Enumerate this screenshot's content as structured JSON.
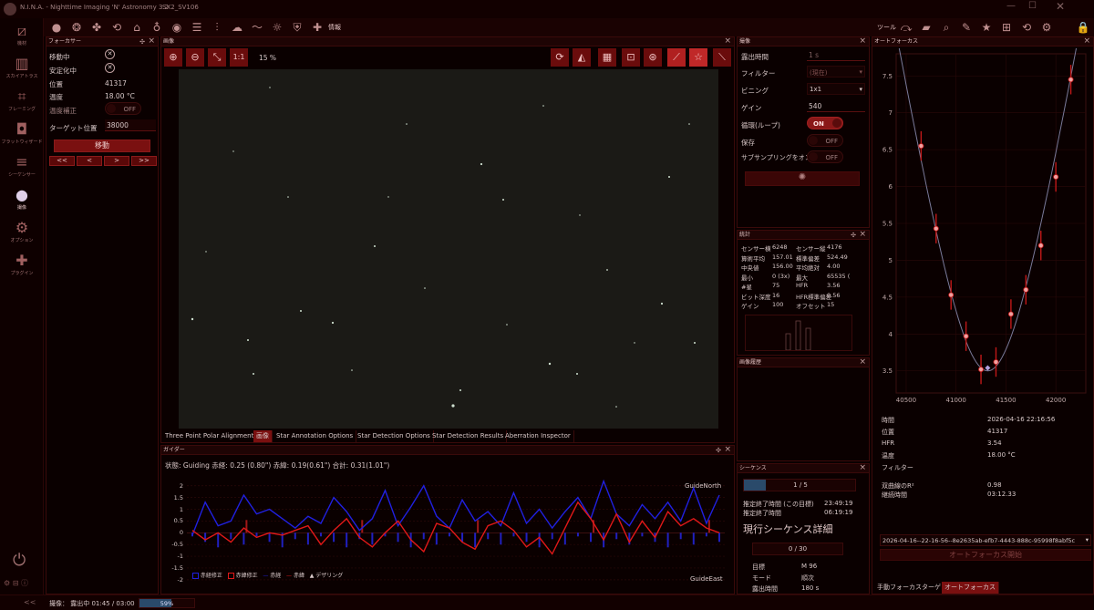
{
  "titlebar": {
    "app": "N.I.N.A. - Nighttime Imaging 'N' Astronomy 3.2",
    "profile": "SX2_SV106",
    "info_label": "情報",
    "tools_label": "ツール"
  },
  "sidebar": {
    "items": [
      {
        "label": "機材",
        "icon": "telescope-icon"
      },
      {
        "label": "スカイアトラス",
        "icon": "atlas-icon"
      },
      {
        "label": "フレーミング",
        "icon": "framing-icon"
      },
      {
        "label": "フラットウィザード",
        "icon": "flat-icon"
      },
      {
        "label": "シーケンサー",
        "icon": "sequencer-icon"
      },
      {
        "label": "撮像",
        "icon": "imaging-icon"
      },
      {
        "label": "オプション",
        "icon": "gear-icon"
      },
      {
        "label": "プラグイン",
        "icon": "puzzle-icon"
      }
    ]
  },
  "focuser": {
    "title": "フォーカサー",
    "moving_label": "移動中",
    "settled_label": "安定化中",
    "position_label": "位置",
    "position": "41317",
    "temp_label": "温度",
    "temp": "18.00 °C",
    "tempcomp_label": "温度補正",
    "tempcomp": "OFF",
    "target_label": "ターゲット位置",
    "target": "38000",
    "move_button": "移動",
    "step_buttons": [
      "<<",
      "<",
      ">",
      ">>"
    ]
  },
  "image": {
    "title": "画像",
    "zoom_fit": "1:1",
    "zoom": "15 %"
  },
  "imaging": {
    "title": "撮像",
    "rows": [
      {
        "label": "露出時間",
        "value": "1 s"
      },
      {
        "label": "フィルター",
        "value": "(現在)"
      },
      {
        "label": "ビニング",
        "value": "1x1"
      },
      {
        "label": "ゲイン",
        "value": "540"
      }
    ],
    "loop_label": "循環(ループ)",
    "loop": "ON",
    "save_label": "保存",
    "save": "OFF",
    "subsample_label": "サブサンプリングをオンに",
    "subsample": "OFF"
  },
  "statistics": {
    "title": "統計",
    "rows": [
      [
        "センサー横",
        "6248",
        "センサー縦",
        "4176"
      ],
      [
        "算術平均",
        "157.01",
        "標準偏差",
        "524.49"
      ],
      [
        "中央値",
        "156.00",
        "平均絶対",
        "4.00"
      ],
      [
        "最小",
        "0 (3x)",
        "最大",
        "65535 ("
      ],
      [
        "#星",
        "75",
        "HFR",
        "3.56"
      ],
      [
        "ビット深度",
        "16",
        "HFR標準偏差",
        "0.56"
      ],
      [
        "ゲイン",
        "100",
        "オフセット",
        "15"
      ]
    ]
  },
  "history": {
    "title": "画像履歴"
  },
  "tabs": [
    "Three Point Polar Alignment",
    "画像",
    "Star Annotation Options",
    "Star Detection Options",
    "Star Detection Results",
    "Aberration Inspector"
  ],
  "guider": {
    "title": "ガイダー",
    "status": "状態: Guiding  赤経: 0.25 (0.80\")  赤緯: 0.19(0.61\")  合計: 0.31(1.01\")",
    "north_label": "GuideNorth",
    "east_label": "GuideEast",
    "legend": [
      "赤経修正",
      "赤緯修正",
      "赤経",
      "赤緯",
      "デザリング"
    ],
    "colors": {
      "ra": "#2020e0",
      "dec": "#e01818"
    }
  },
  "sequence": {
    "title": "シーケンス",
    "progress": "1 / 5",
    "eta_label": "推定終了時間 (この目標)",
    "eta": "23:49:19",
    "eta2_label": "推定終了時間",
    "eta2": "06:19:19",
    "detail_title": "現行シーケンス詳細",
    "count": "0 / 30",
    "target_label": "目標",
    "target": "M 96",
    "mode_label": "モード",
    "mode": "順次",
    "exposure_label": "露出時間",
    "exposure": "180 s"
  },
  "autofocus": {
    "title": "オートフォーカス",
    "info": [
      {
        "label": "時間",
        "value": "2026-04-16 22:16:56"
      },
      {
        "label": "位置",
        "value": "41317"
      },
      {
        "label": "HFR",
        "value": "3.54"
      },
      {
        "label": "温度",
        "value": "18.00 °C"
      },
      {
        "label": "フィルター",
        "value": ""
      },
      {
        "label": "双曲線のR²",
        "value": "0.98"
      },
      {
        "label": "継続時間",
        "value": "03:12.33"
      }
    ],
    "run_select": "2026-04-16--22-16-56--8e2635ab-efb7-4443-888c-95998f8abf5c",
    "start_button": "オートフォーカス開始",
    "tabs": [
      "手動フォーカスターゲット",
      "オートフォーカス"
    ]
  },
  "statusbar": {
    "text": "撮像：  露出中 01:45 / 03:00",
    "progress": 0.59,
    "progress_label": "59%"
  },
  "chart_data": [
    {
      "type": "scatter",
      "title": "",
      "x": [
        40650,
        40800,
        40950,
        41100,
        41250,
        41400,
        41550,
        41700,
        41850,
        42000,
        42150
      ],
      "y": [
        6.55,
        5.43,
        4.53,
        3.97,
        3.52,
        3.62,
        4.27,
        4.6,
        5.2,
        6.13,
        7.45
      ],
      "fit_minimum": {
        "x": 41317,
        "y": 3.54
      },
      "xlim": [
        40400,
        42300
      ],
      "ylim": [
        3.2,
        7.8
      ],
      "xticks": [
        40500,
        41000,
        41500,
        42000
      ],
      "yticks": [
        3.5,
        4,
        4.5,
        5,
        5.5,
        6,
        6.5,
        7,
        7.5
      ]
    },
    {
      "type": "line",
      "series": [
        {
          "name": "赤経",
          "values": [
            -0.1,
            1.3,
            0.3,
            0.5,
            1.6,
            0.8,
            1.0,
            0.6,
            0.2,
            0.7,
            0.4,
            1.5,
            0.9,
            0.1,
            0.6,
            1.8,
            0.3,
            1.1,
            2.0,
            0.7,
            0.2,
            1.4,
            0.5,
            0.9,
            0.3,
            1.7,
            0.4,
            1.0,
            0.2,
            0.9,
            1.5,
            0.6,
            2.2,
            0.8,
            0.3,
            1.2,
            0.6,
            1.3,
            0.5,
            1.9,
            0.4,
            1.6
          ]
        },
        {
          "name": "赤緯",
          "values": [
            0.1,
            -0.3,
            0.0,
            -0.4,
            0.2,
            -0.2,
            0.0,
            -0.1,
            0.1,
            0.3,
            -0.5,
            0.1,
            0.6,
            -0.2,
            -0.6,
            0.0,
            0.5,
            -0.3,
            -0.8,
            0.4,
            0.2,
            -0.4,
            -0.7,
            0.3,
            0.5,
            0.1,
            -0.6,
            -0.2,
            -0.9,
            0.2,
            1.3,
            0.6,
            -0.3,
            0.8,
            -0.4,
            0.5,
            -0.2,
            0.9,
            0.3,
            0.6,
            0.2,
            0.0
          ]
        }
      ],
      "ylim": [
        -2.2,
        2.3
      ],
      "yticks": [
        2,
        1.5,
        1,
        0.5,
        0,
        -0.5,
        -1,
        -1.5,
        -2
      ]
    }
  ]
}
